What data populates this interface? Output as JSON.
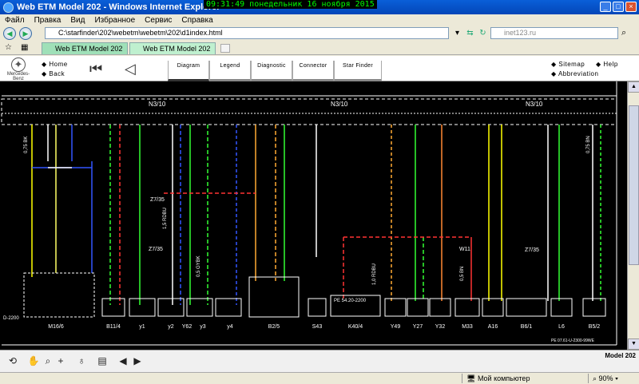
{
  "window": {
    "title": "Web ETM Model 202 - Windows Internet Explorer",
    "clock": "09:31:49  понедельник 16 ноября 2015",
    "min": "_",
    "max": "□",
    "close": "×"
  },
  "menu": [
    "Файл",
    "Правка",
    "Вид",
    "Избранное",
    "Сервис",
    "Справка"
  ],
  "address": {
    "url": "C:\\starfinder\\202\\webetm\\webetm\\202\\d1index.html",
    "search_placeholder": "inet123.ru"
  },
  "tabs": [
    {
      "label": "Web ETM Model 202"
    },
    {
      "label": "Web ETM Model 202"
    }
  ],
  "etm": {
    "logo_text": "Mercedes-Benz",
    "home": "Home",
    "back": "Back",
    "tabs": [
      "Diagram",
      "Legend",
      "Diagnostic",
      "Connector",
      "Star Finder"
    ],
    "sitemap": "Sitemap",
    "help": "Help",
    "abbreviation": "Abbreviation"
  },
  "schematic": {
    "connectors": [
      "N3/10",
      "N3/10",
      "N3/10"
    ],
    "left_labels": [
      "Z7/35",
      "Z7/35",
      "Z7/35",
      "W11"
    ],
    "components": [
      "M16/6",
      "B11/4",
      "y1",
      "y2",
      "Y62",
      "y3",
      "y4",
      "B2/5",
      "S43",
      "K40/4",
      "Y49",
      "Y27",
      "Y32",
      "M33",
      "A16",
      "B6/1",
      "L6",
      "B5/2"
    ],
    "pe_labels": [
      "PE 54.20-2200",
      "D-2200",
      "PE 07.61-U-2300-99WE"
    ],
    "wire_labels": [
      "0,75 BK",
      "1,5 RDBU",
      "0,5 GYBK",
      "1,0 RDBU",
      "0,5 BN",
      "0,75 BN"
    ]
  },
  "viewer": {
    "model": "Model 202"
  },
  "status": {
    "computer": "Мой компьютер",
    "zoom": "90%"
  }
}
